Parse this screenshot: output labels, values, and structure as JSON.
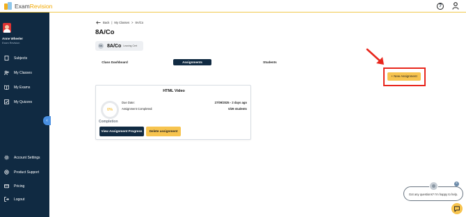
{
  "brand": {
    "name_prefix": "Exam",
    "name_suffix": "Revision"
  },
  "colors": {
    "sidebar": "#102a42",
    "accent_yellow": "#f7c44f",
    "highlight_red": "#e8261c",
    "progress_orange": "#f2a900"
  },
  "profile": {
    "name": "Anne Wheeler",
    "subtitle": "Exam Revision"
  },
  "sidebar": {
    "items": [
      {
        "label": "Subjects",
        "icon": "subjects-icon"
      },
      {
        "label": "My Classes",
        "icon": "classes-icon"
      },
      {
        "label": "My Exams",
        "icon": "exams-icon"
      },
      {
        "label": "My Quizzes",
        "icon": "quizzes-icon"
      }
    ],
    "bottom_items": [
      {
        "label": "Account Settings",
        "icon": "gear-icon"
      },
      {
        "label": "Product Support",
        "icon": "support-icon"
      },
      {
        "label": "Pricing",
        "icon": "pricing-icon"
      },
      {
        "label": "Logout",
        "icon": "logout-icon"
      }
    ],
    "collapse_glyph": "‹"
  },
  "breadcrumb": {
    "back": "Back",
    "sep1": "|",
    "item1": "My Classes",
    "sep2": ">",
    "item2": "8A/Co"
  },
  "page": {
    "title": "8A/Co"
  },
  "class_chip": {
    "icon_text": "8A",
    "name": "8A/Co",
    "level": "Leaving Cert"
  },
  "tabs": [
    {
      "label": "Class Dashboard",
      "active": false
    },
    {
      "label": "Assignments",
      "active": true
    },
    {
      "label": "Students",
      "active": false
    }
  ],
  "new_assignment": {
    "label": "+ New Assignment"
  },
  "assignment_card": {
    "title": "HTML Video",
    "completion_percent": "0%",
    "completion_label": "Completion",
    "due_label": "Due Date:",
    "due_value": "27/09/2025 - 2 days ago",
    "completed_label": "Assignment Completed:",
    "completed_value": "0/29 students",
    "progress_button": "View Assignment Progress",
    "delete_button": "Delete assignment"
  },
  "chat": {
    "message": "Got any questions? I'm happy to help.",
    "close_glyph": "×"
  }
}
